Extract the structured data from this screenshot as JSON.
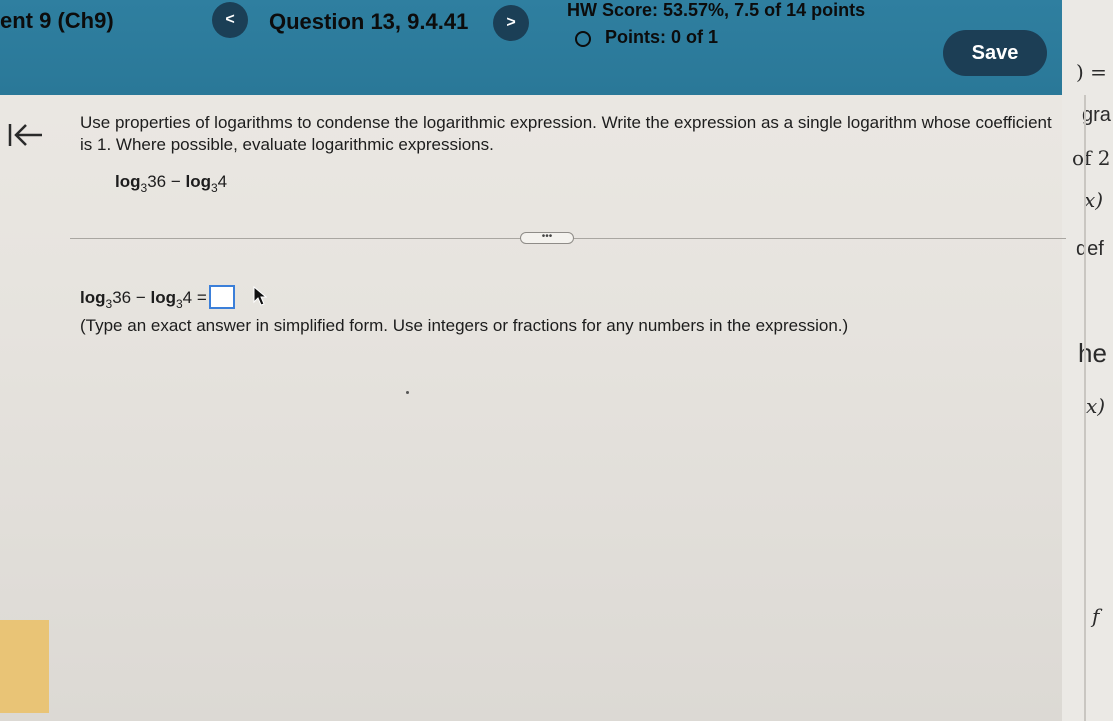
{
  "header": {
    "assignment_title": "ent 9 (Ch9)",
    "prev_label": "<",
    "question_title": "Question 13, 9.4.41",
    "next_label": ">",
    "hw_score": "HW Score: 53.57%, 7.5 of 14 points",
    "points": "Points: 0 of 1",
    "save_label": "Save"
  },
  "question": {
    "instructions": "Use properties of logarithms to condense the logarithmic expression. Write the expression as a single logarithm whose coefficient is 1. Where possible, evaluate logarithmic expressions.",
    "given": {
      "log1": "log",
      "base1": "3",
      "arg1": "36",
      "minus": " − ",
      "log2": "log",
      "base2": "3",
      "arg2": "4"
    },
    "more_label": "•••",
    "answer": {
      "log1": "log",
      "base1": "3",
      "arg1": "36",
      "minus": " − ",
      "log2": "log",
      "base2": "3",
      "arg2": "4",
      "equals": " ="
    },
    "hint": "(Type an exact answer in simplified form. Use integers or fractions for any numbers in the expression.)"
  },
  "side_fragments": {
    "f1": ") =",
    "f2": "gra",
    "f3": "of 2",
    "f4": "x)",
    "f5": "def",
    "f6": "he",
    "f7": "x)",
    "f8": "f"
  },
  "colors": {
    "header_bg": "#2f7fa0",
    "save_bg": "#1c3e55",
    "answer_box_border": "#3b7fd9"
  }
}
